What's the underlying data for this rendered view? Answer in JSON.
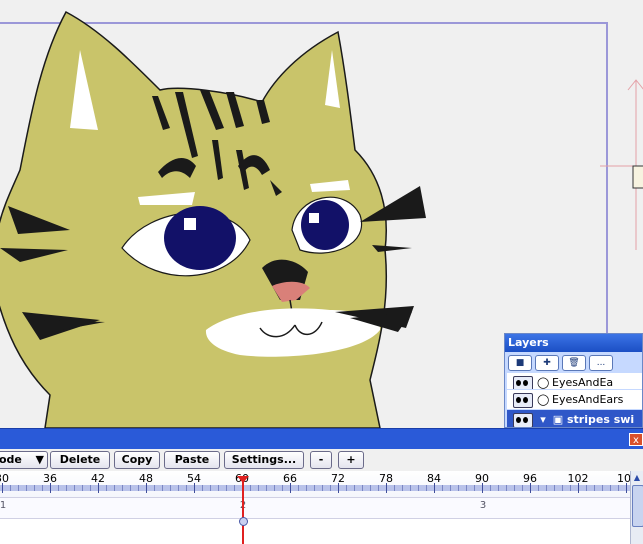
{
  "canvas": {
    "fill_colors": {
      "face": "#c9c46a",
      "eye_iris": "#121168",
      "nose": "#d98079",
      "muzzle": "#ffffff"
    }
  },
  "layers_panel": {
    "title": "Layers",
    "toolbar": [
      "new-layer-icon",
      "add-layer-icon",
      "trash-icon",
      "more-options-icon"
    ],
    "toolbar_labels": [
      "",
      "",
      "",
      "..."
    ],
    "rows": [
      {
        "label": "EyesAndEa",
        "icon": "ear-shape-icon",
        "selected": false
      },
      {
        "label": "EyesAndEars",
        "icon": "ear-shape-icon",
        "selected": false
      },
      {
        "label": "stripes swi",
        "icon": "folder-icon",
        "selected": true
      }
    ]
  },
  "timeline": {
    "close_label": "x",
    "mode_label": "ode",
    "buttons": {
      "delete": "Delete",
      "copy": "Copy",
      "paste": "Paste",
      "settings": "Settings...",
      "minus": "-",
      "plus": "+"
    },
    "ruler_labels": [
      "30",
      "36",
      "42",
      "48",
      "54",
      "60",
      "66",
      "72",
      "78",
      "84",
      "90",
      "96",
      "102",
      "10"
    ],
    "current_frame": "60",
    "frame_markers": [
      "1",
      "2",
      "3"
    ],
    "playhead_color": "#e02020"
  }
}
